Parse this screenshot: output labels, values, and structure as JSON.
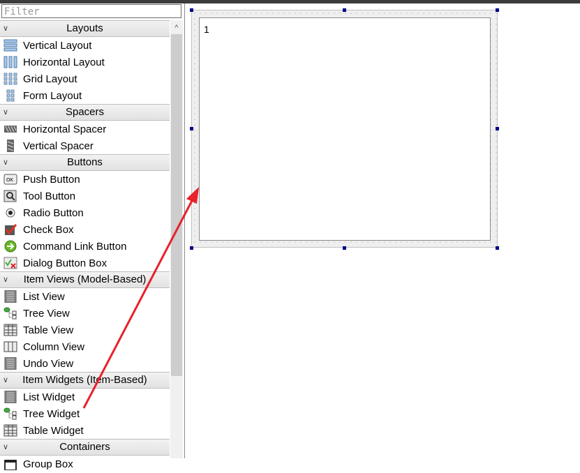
{
  "filter": {
    "placeholder": "Filter"
  },
  "categories": [
    {
      "title": "Layouts",
      "items": [
        {
          "label": "Vertical Layout",
          "icon": "vertical-layout-icon"
        },
        {
          "label": "Horizontal Layout",
          "icon": "horizontal-layout-icon"
        },
        {
          "label": "Grid Layout",
          "icon": "grid-layout-icon"
        },
        {
          "label": "Form Layout",
          "icon": "form-layout-icon"
        }
      ]
    },
    {
      "title": "Spacers",
      "items": [
        {
          "label": "Horizontal Spacer",
          "icon": "horizontal-spacer-icon"
        },
        {
          "label": "Vertical Spacer",
          "icon": "vertical-spacer-icon"
        }
      ]
    },
    {
      "title": "Buttons",
      "items": [
        {
          "label": "Push Button",
          "icon": "push-button-icon"
        },
        {
          "label": "Tool Button",
          "icon": "tool-button-icon"
        },
        {
          "label": "Radio Button",
          "icon": "radio-button-icon"
        },
        {
          "label": "Check Box",
          "icon": "check-box-icon"
        },
        {
          "label": "Command Link Button",
          "icon": "command-link-icon"
        },
        {
          "label": "Dialog Button Box",
          "icon": "dialog-button-box-icon"
        }
      ]
    },
    {
      "title": "Item Views (Model-Based)",
      "items": [
        {
          "label": "List View",
          "icon": "list-icon"
        },
        {
          "label": "Tree View",
          "icon": "tree-icon"
        },
        {
          "label": "Table View",
          "icon": "table-icon"
        },
        {
          "label": "Column View",
          "icon": "column-icon"
        },
        {
          "label": "Undo View",
          "icon": "list-icon"
        }
      ]
    },
    {
      "title": "Item Widgets (Item-Based)",
      "items": [
        {
          "label": "List Widget",
          "icon": "list-icon"
        },
        {
          "label": "Tree Widget",
          "icon": "tree-icon"
        },
        {
          "label": "Table Widget",
          "icon": "table-icon"
        }
      ]
    },
    {
      "title": "Containers",
      "items": [
        {
          "label": "Group Box",
          "icon": "group-box-icon"
        }
      ]
    }
  ],
  "canvas": {
    "widget_text": "1"
  },
  "colors": {
    "arrow": "#e8212b",
    "handle": "#00008b"
  }
}
